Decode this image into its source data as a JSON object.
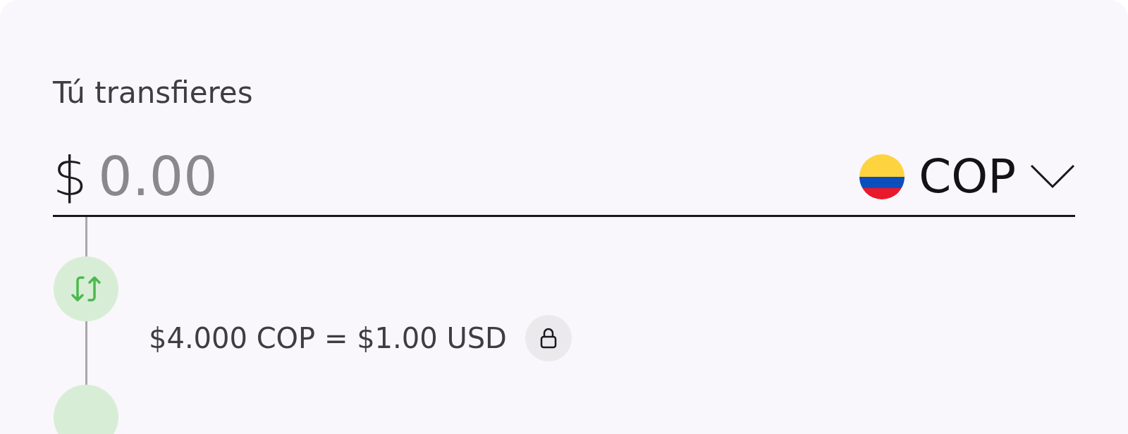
{
  "label": "Tú transfieres",
  "amount": {
    "prefix": "$",
    "placeholder": "0.00"
  },
  "currency": {
    "code": "COP"
  },
  "rate": {
    "text": "$4.000 COP = $1.00 USD",
    "locked": true
  }
}
